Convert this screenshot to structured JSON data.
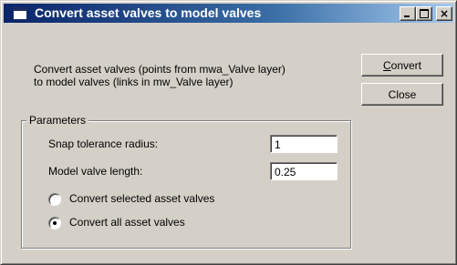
{
  "window": {
    "title": "Convert asset valves to model valves",
    "icon": "window-app-icon",
    "controls": {
      "minimize": "_",
      "maximize": "□",
      "close": "×"
    }
  },
  "description": {
    "line1": "Convert asset valves (points from mwa_Valve layer)",
    "line2": "to model valves (links in mw_Valve layer)"
  },
  "buttons": {
    "convert_access": "C",
    "convert_rest": "onvert",
    "close": "Close"
  },
  "parameters": {
    "group_title": "Parameters",
    "snap_label": "Snap tolerance radius:",
    "snap_value": "1",
    "length_label": "Model valve length:",
    "length_value": "0.25",
    "option_selected": "Convert selected asset valves",
    "option_all": "Convert all asset valves",
    "selected_option": "all"
  }
}
